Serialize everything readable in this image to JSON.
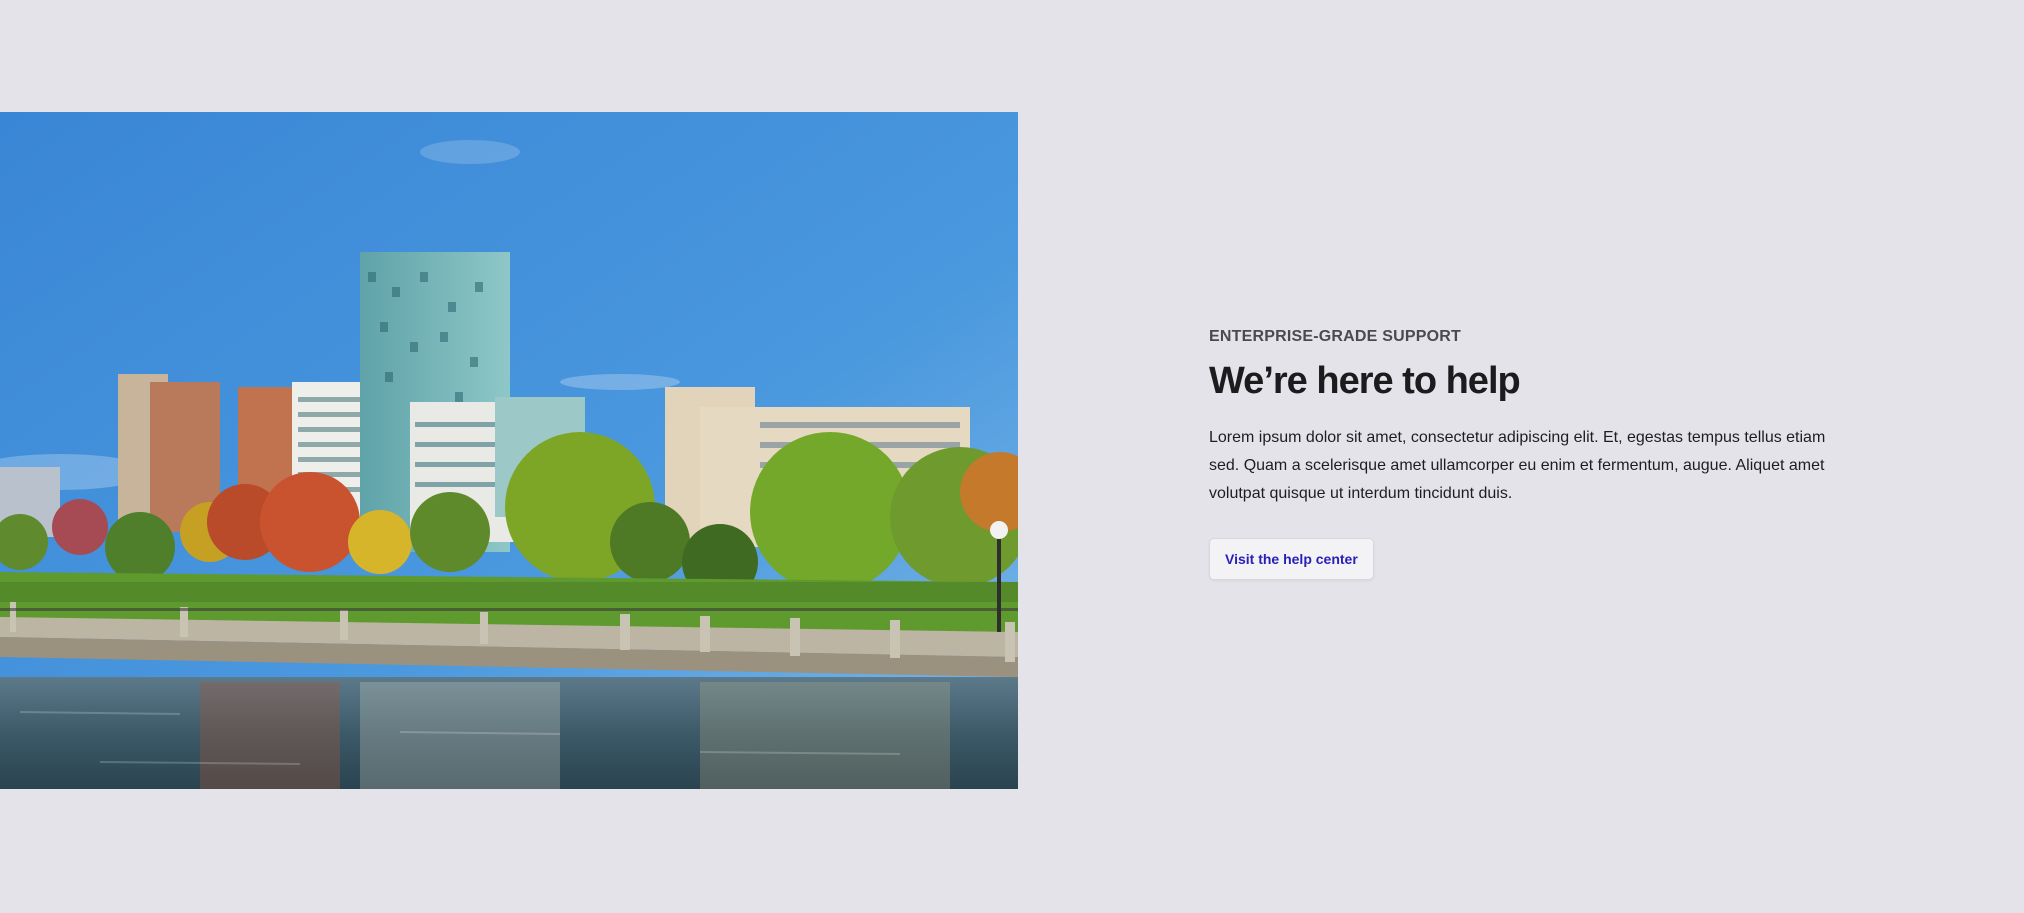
{
  "hero": {
    "image_description": "campus-buildings-by-the-river"
  },
  "section": {
    "eyebrow": "ENTERPRISE-GRADE SUPPORT",
    "title": "We’re here to help",
    "body": "Lorem ipsum dolor sit amet, consectetur adipiscing elit. Et, egestas tempus tellus etiam sed. Quam a scelerisque amet ullamcorper eu enim et fermentum, augue. Aliquet amet volutpat quisque ut interdum tincidunt duis.",
    "cta_label": "Visit the help center"
  },
  "colors": {
    "page_background": "#e4e3e9",
    "accent": "#2a20b8",
    "heading": "#1c1c1e"
  }
}
